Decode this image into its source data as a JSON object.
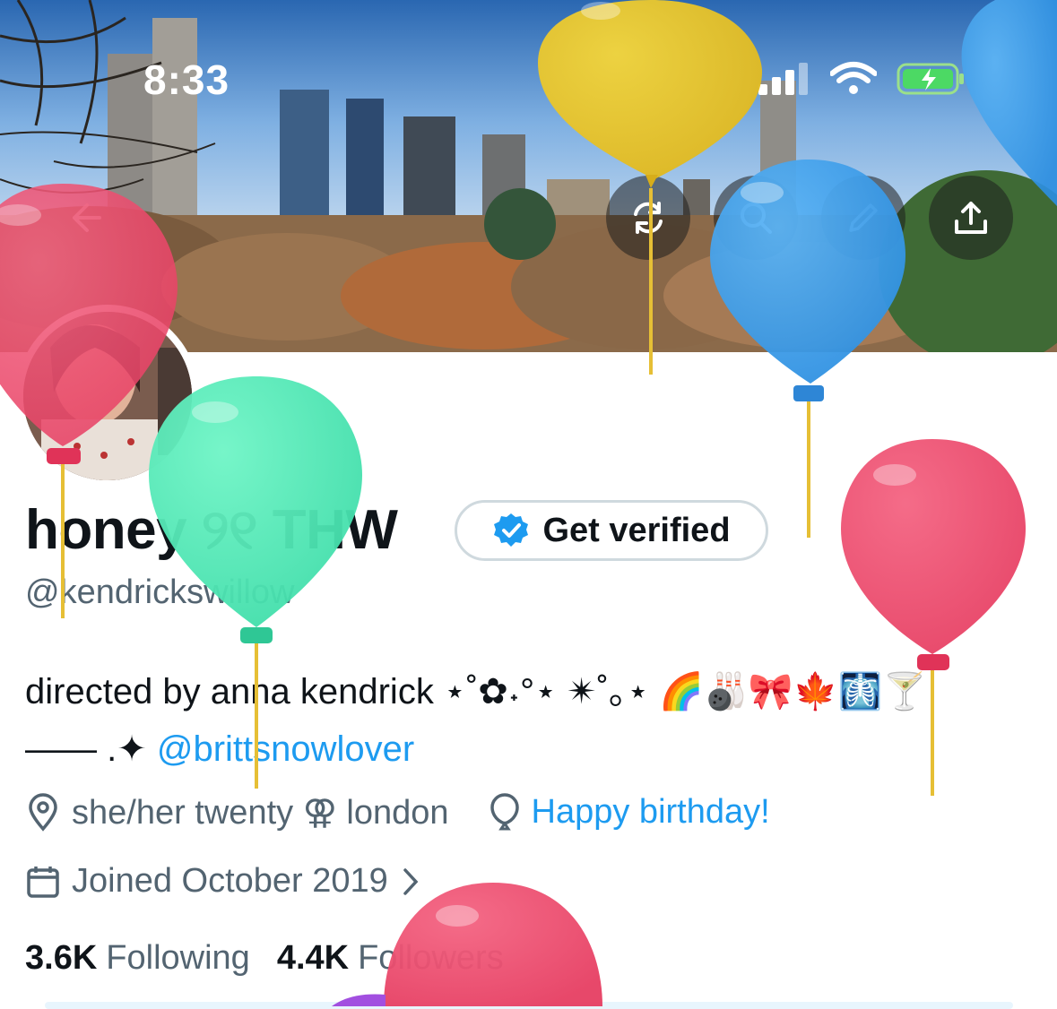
{
  "status_bar": {
    "time": "8:33"
  },
  "header_actions": {
    "back": "back-arrow-icon",
    "refresh": "refresh-icon",
    "search": "search-icon",
    "edit": "pencil-icon",
    "share": "share-icon"
  },
  "profile": {
    "display_name": "honey ୨୧ THW",
    "verify_label": "Get verified",
    "handle": "@kendrickswillow",
    "bio_line1": "directed by anna kendrick ⋆˚✿˖°⋆ ✴˚｡⋆ 🌈🎳🎀🍁🩻🍸",
    "bio_line2_prefix": "——  .✦ ",
    "bio_mention": "@brittsnowlover",
    "location": "she/her twenty ⚢ london",
    "birthday": "Happy birthday!",
    "joined": "Joined October 2019",
    "following_count": "3.6K",
    "following_label": "Following",
    "followers_count": "4.4K",
    "followers_label": "Followers"
  },
  "colors": {
    "accent": "#1d9bf0",
    "secondary_text": "#536471",
    "primary_text": "#0f1419",
    "verify_badge": "#1d9bf0"
  }
}
